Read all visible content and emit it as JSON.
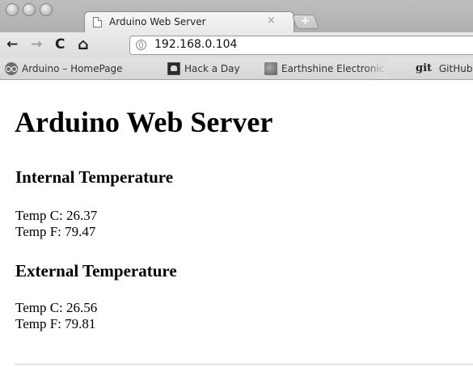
{
  "tab": {
    "title": "Arduino Web Server",
    "close_glyph": "×",
    "new_tab_glyph": "+"
  },
  "toolbar": {
    "back_glyph": "←",
    "forward_glyph": "→",
    "reload_glyph": "C",
    "home_glyph": "⌂",
    "url": "192.168.0.104"
  },
  "bookmarks": [
    {
      "label": "Arduino – HomePage",
      "icon": "arduino-icon"
    },
    {
      "label": "Hack a Day",
      "icon": "hackaday-icon"
    },
    {
      "label": "Earthshine Electronic",
      "icon": "earthshine-icon"
    },
    {
      "label": "GitHub",
      "icon": "git-icon",
      "icon_text": "git"
    }
  ],
  "page": {
    "heading": "Arduino Web Server",
    "sections": [
      {
        "title": "Internal Temperature",
        "temp_c": "Temp C: 26.37",
        "temp_f": "Temp F: 79.47"
      },
      {
        "title": "External Temperature",
        "temp_c": "Temp C: 26.56",
        "temp_f": "Temp F: 79.81"
      }
    ]
  }
}
